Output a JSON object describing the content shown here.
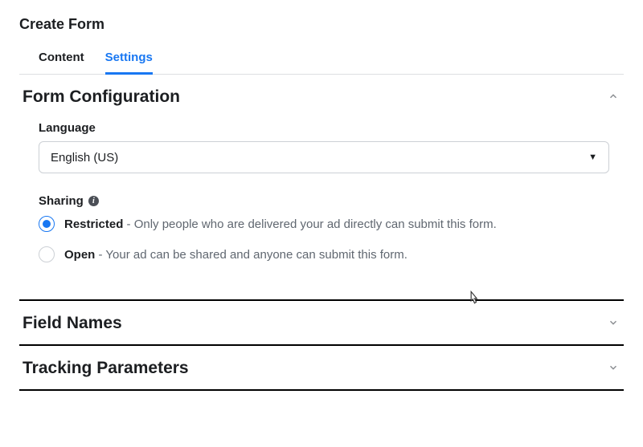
{
  "page_title": "Create Form",
  "tabs": {
    "content": "Content",
    "settings": "Settings"
  },
  "sections": {
    "form_config": {
      "title": "Form Configuration",
      "language_label": "Language",
      "language_value": "English (US)",
      "sharing_label": "Sharing",
      "options": {
        "restricted": {
          "name": "Restricted",
          "desc": " - Only people who are delivered your ad directly can submit this form."
        },
        "open": {
          "name": "Open",
          "desc": " - Your ad can be shared and anyone can submit this form."
        }
      }
    },
    "field_names": {
      "title": "Field Names"
    },
    "tracking": {
      "title": "Tracking Parameters"
    }
  }
}
